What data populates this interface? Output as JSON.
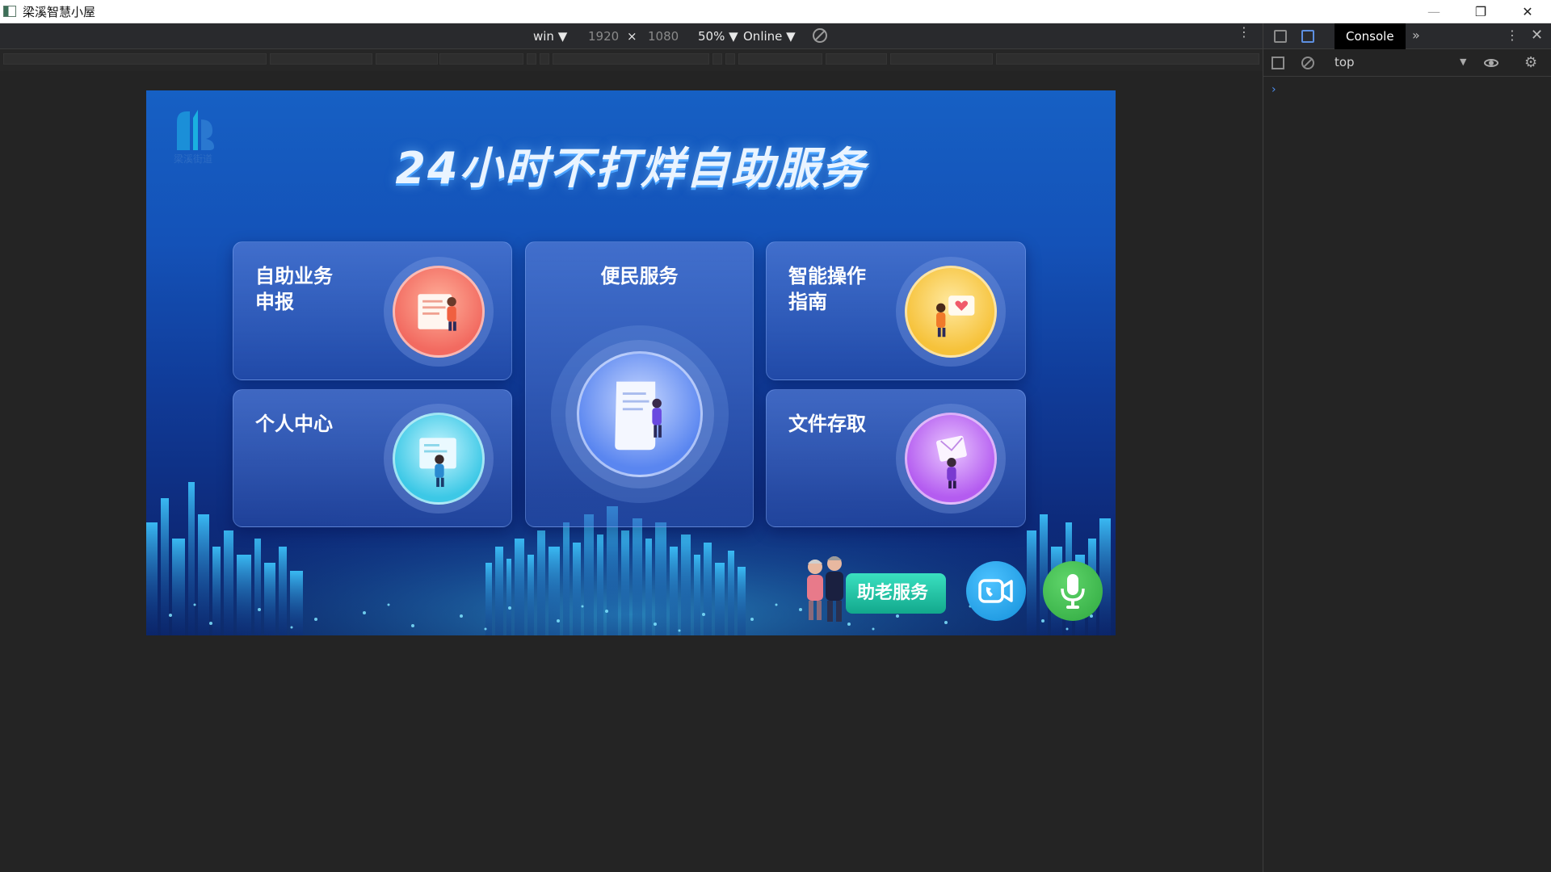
{
  "window": {
    "title": "梁溪智慧小屋",
    "controls": [
      "minimize",
      "restore",
      "close"
    ]
  },
  "device_toolbar": {
    "device": "win ▼",
    "width": "1920",
    "times": "×",
    "height": "1080",
    "zoom": "50% ▼",
    "network": "Online ▼",
    "more": "⋮"
  },
  "devtools": {
    "console_tab": "Console",
    "more_tabs": "»",
    "kebab": "⋮",
    "close": "✕",
    "context": "top",
    "context_caret": "▼",
    "prompt": "›"
  },
  "app": {
    "logo_caption": "梁溪街道",
    "headline": "24小时不打烊自助服务",
    "cards": {
      "self_service": "自助业务\n申报",
      "convenience": "便民服务",
      "guide": "智能操作\n指南",
      "personal": "个人中心",
      "files": "文件存取"
    },
    "elder_service": "助老服务",
    "icons": {
      "video_call": "video-call-icon",
      "microphone": "microphone-icon"
    },
    "colors": {
      "bg_top": "#1660c4",
      "bg_bottom": "#0a1f5c",
      "orb_red": "#f26a60",
      "orb_blue": "#5a86f0",
      "orb_yellow": "#f6c23a",
      "orb_cyan": "#3cc8e6",
      "orb_purple": "#b45cf0",
      "elder_btn": "#20c0a0",
      "video_btn": "#1fa6ea",
      "mic_btn": "#3dbb4d"
    }
  }
}
